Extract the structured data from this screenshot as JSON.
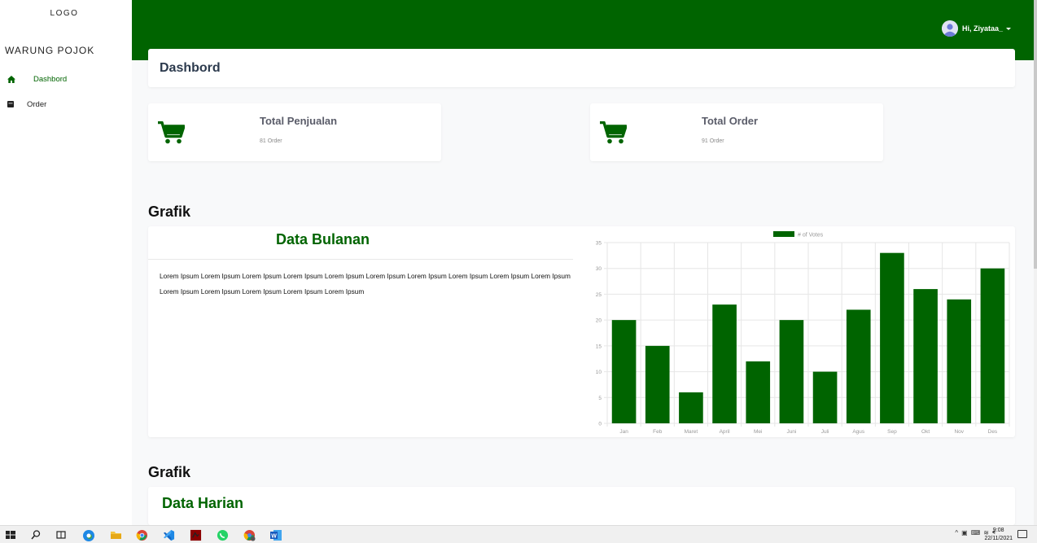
{
  "sidebar": {
    "logo": "LOGO",
    "brand": "WARUNG POJOK",
    "items": [
      {
        "label": "Dashbord",
        "icon": "home-icon",
        "active": true
      },
      {
        "label": "Order",
        "icon": "clipboard-icon",
        "active": false
      }
    ]
  },
  "topbar": {
    "user_greeting": "Hi, Ziyataa_",
    "color": "#006400"
  },
  "page": {
    "title": "Dashbord"
  },
  "stats": [
    {
      "title": "Total Penjualan",
      "sub": "81 Order",
      "icon": "shopping-cart-icon"
    },
    {
      "title": "Total Order",
      "sub": "91 Order",
      "icon": "shopping-cart-icon"
    }
  ],
  "sections": [
    {
      "title": "Grafik",
      "heading": "Data Bulanan"
    },
    {
      "title": "Grafik",
      "heading": "Data Harian"
    }
  ],
  "monthly_text": "Lorem Ipsum Lorem Ipsum Lorem Ipsum Lorem Ipsum Lorem Ipsum Lorem Ipsum Lorem Ipsum Lorem Ipsum Lorem Ipsum Lorem Ipsum Lorem Ipsum Lorem Ipsum Lorem Ipsum Lorem Ipsum Lorem Ipsum",
  "chart_data": {
    "type": "bar",
    "categories": [
      "Jan",
      "Feb",
      "Maret",
      "April",
      "Mei",
      "Juni",
      "Juli",
      "Agus",
      "Sep",
      "Okt",
      "Nov",
      "Des"
    ],
    "series": [
      {
        "name": "# of Votes",
        "values": [
          20,
          15,
          6,
          23,
          12,
          20,
          10,
          22,
          33,
          26,
          24,
          30
        ]
      }
    ],
    "ylim": [
      0,
      35
    ],
    "yticks": [
      0,
      5,
      10,
      15,
      20,
      25,
      30,
      35
    ],
    "color": "#006400",
    "grid": true,
    "legend": "top"
  },
  "taskbar": {
    "apps": [
      "windows-start-icon",
      "search-icon",
      "task-view-icon",
      "edge-icon",
      "file-explorer-icon",
      "chrome-icon",
      "vscode-icon",
      "app-icon",
      "whatsapp-icon",
      "chrome-profile-icon",
      "word-icon"
    ],
    "time": "9:08",
    "date": "22/11/2021"
  }
}
